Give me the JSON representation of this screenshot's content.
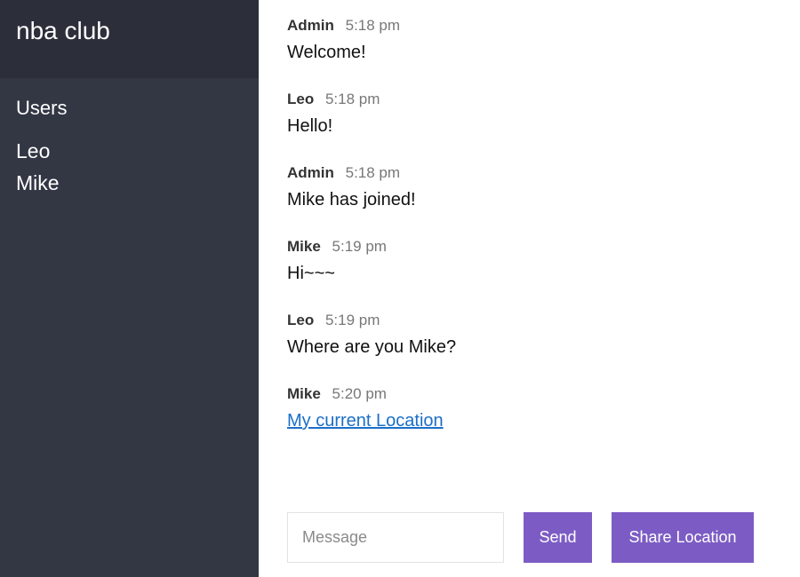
{
  "sidebar": {
    "room_name": "nba club",
    "users_title": "Users",
    "users": [
      "Leo",
      "Mike"
    ]
  },
  "messages": [
    {
      "name": "Admin",
      "time": "5:18 pm",
      "text": "Welcome!"
    },
    {
      "name": "Leo",
      "time": "5:18 pm",
      "text": "Hello!"
    },
    {
      "name": "Admin",
      "time": "5:18 pm",
      "text": "Mike has joined!"
    },
    {
      "name": "Mike",
      "time": "5:19 pm",
      "text": "Hi~~~"
    },
    {
      "name": "Leo",
      "time": "5:19 pm",
      "text": "Where are you Mike?"
    },
    {
      "name": "Mike",
      "time": "5:20 pm",
      "link_text": "My current Location"
    }
  ],
  "compose": {
    "value": "",
    "placeholder": "Message",
    "send_label": "Send",
    "share_label": "Share Location"
  },
  "colors": {
    "sidebar_bg": "#333744",
    "header_bg": "#2c2f3a",
    "button_bg": "#7c5cc4",
    "link": "#1a6fc9"
  }
}
